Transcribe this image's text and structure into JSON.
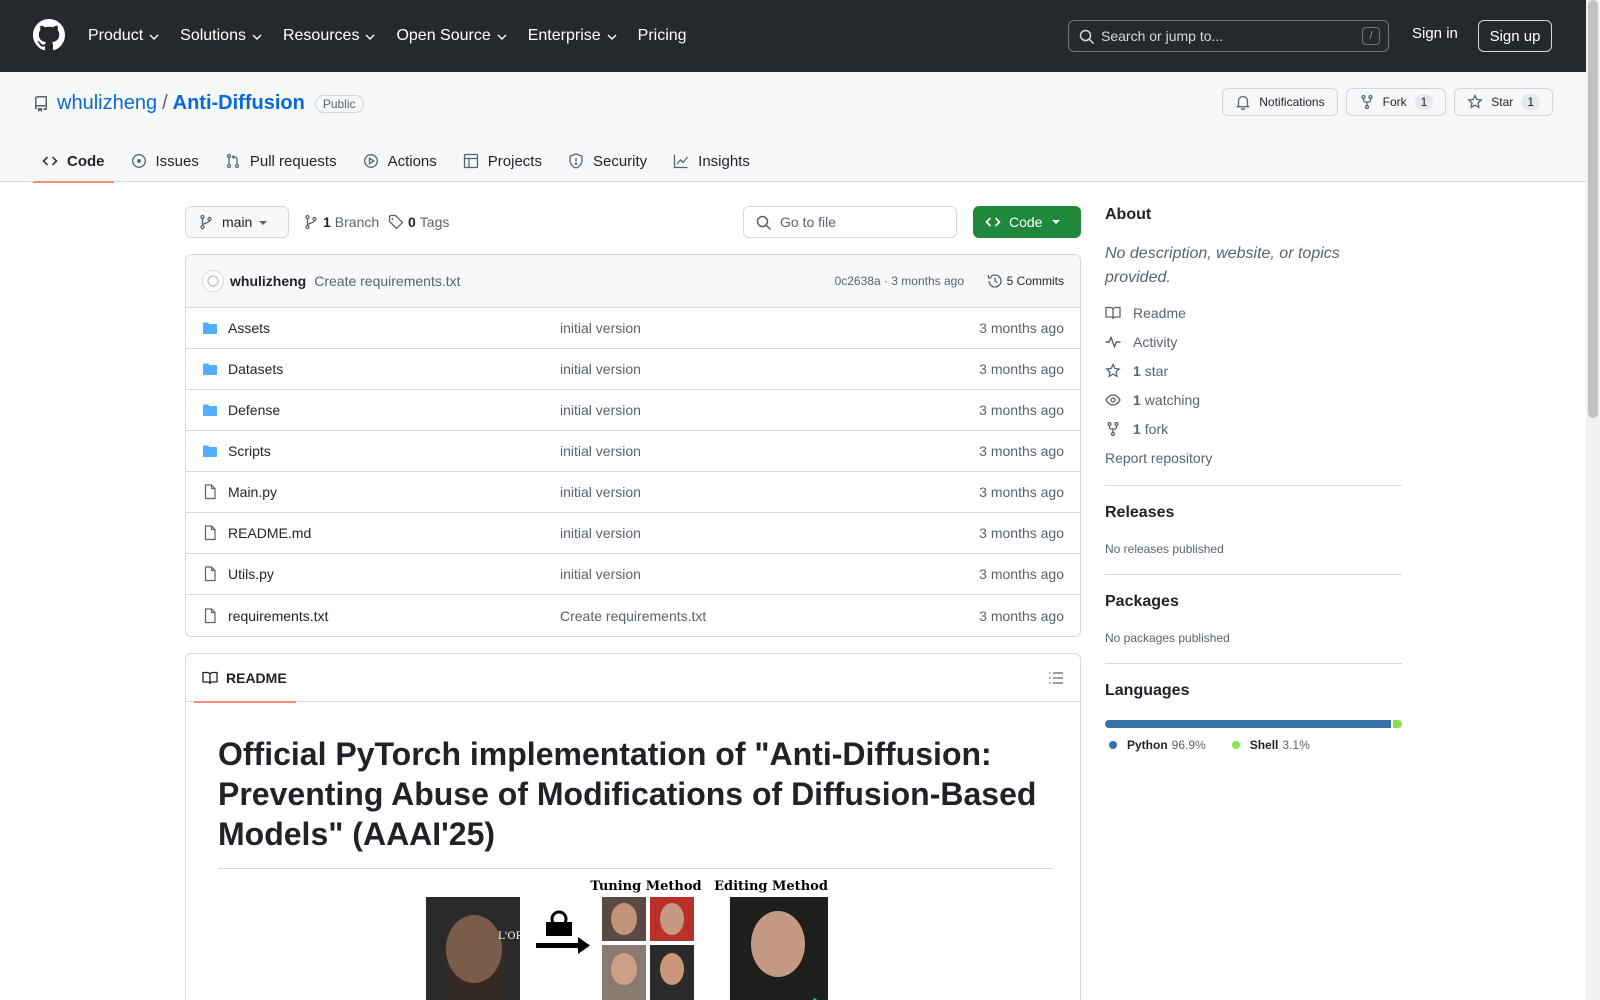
{
  "header": {
    "nav": [
      {
        "label": "Product",
        "chevron": true
      },
      {
        "label": "Solutions",
        "chevron": true
      },
      {
        "label": "Resources",
        "chevron": true
      },
      {
        "label": "Open Source",
        "chevron": true
      },
      {
        "label": "Enterprise",
        "chevron": true
      },
      {
        "label": "Pricing",
        "chevron": false
      }
    ],
    "search_placeholder": "Search or jump to...",
    "search_shortcut": "/",
    "signin": "Sign in",
    "signup": "Sign up"
  },
  "repo": {
    "owner": "whulizheng",
    "separator": "/",
    "name": "Anti-Diffusion",
    "visibility": "Public",
    "notifications": "Notifications",
    "fork_label": "Fork",
    "fork_count": "1",
    "star_label": "Star",
    "star_count": "1"
  },
  "tabs": [
    {
      "label": "Code",
      "icon": "code-icon",
      "active": true
    },
    {
      "label": "Issues",
      "icon": "issue-icon",
      "active": false
    },
    {
      "label": "Pull requests",
      "icon": "pull-request-icon",
      "active": false
    },
    {
      "label": "Actions",
      "icon": "play-icon",
      "active": false
    },
    {
      "label": "Projects",
      "icon": "table-icon",
      "active": false
    },
    {
      "label": "Security",
      "icon": "shield-icon",
      "active": false
    },
    {
      "label": "Insights",
      "icon": "graph-icon",
      "active": false
    }
  ],
  "branchbar": {
    "branch": "main",
    "branch_count": "1",
    "branch_label": "Branch",
    "tag_count": "0",
    "tag_label": "Tags",
    "goto_placeholder": "Go to file",
    "code_button": "Code"
  },
  "commit": {
    "author": "whulizheng",
    "message": "Create requirements.txt",
    "sha_time": "0c2638a · 3 months ago",
    "commits": "5 Commits"
  },
  "files": [
    {
      "type": "folder",
      "name": "Assets",
      "message": "initial version",
      "date": "3 months ago"
    },
    {
      "type": "folder",
      "name": "Datasets",
      "message": "initial version",
      "date": "3 months ago"
    },
    {
      "type": "folder",
      "name": "Defense",
      "message": "initial version",
      "date": "3 months ago"
    },
    {
      "type": "folder",
      "name": "Scripts",
      "message": "initial version",
      "date": "3 months ago"
    },
    {
      "type": "file",
      "name": "Main.py",
      "message": "initial version",
      "date": "3 months ago"
    },
    {
      "type": "file",
      "name": "README.md",
      "message": "initial version",
      "date": "3 months ago"
    },
    {
      "type": "file",
      "name": "Utils.py",
      "message": "initial version",
      "date": "3 months ago"
    },
    {
      "type": "file",
      "name": "requirements.txt",
      "message": "Create requirements.txt",
      "date": "3 months ago"
    }
  ],
  "readme": {
    "tab": "README",
    "title": "Official PyTorch implementation of \"Anti-Diffusion: Preventing Abuse of Modifications of Diffusion-Based Models\" (AAAI'25)",
    "figure_tuning": "Tuning Method",
    "figure_editing": "Editing Method"
  },
  "about": {
    "heading": "About",
    "description": "No description, website, or topics provided.",
    "links": [
      {
        "icon": "book-icon",
        "count": "",
        "label": "Readme"
      },
      {
        "icon": "pulse-icon",
        "count": "",
        "label": "Activity"
      },
      {
        "icon": "star-icon",
        "count": "1",
        "label": "star"
      },
      {
        "icon": "eye-icon",
        "count": "1",
        "label": "watching"
      },
      {
        "icon": "fork-icon",
        "count": "1",
        "label": "fork"
      }
    ],
    "report": "Report repository"
  },
  "releases": {
    "heading": "Releases",
    "empty": "No releases published"
  },
  "packages": {
    "heading": "Packages",
    "empty": "No packages published"
  },
  "languages": {
    "heading": "Languages",
    "items": [
      {
        "name": "Python",
        "percent": "96.9%",
        "value": 96.9,
        "color": "#3572A5"
      },
      {
        "name": "Shell",
        "percent": "3.1%",
        "value": 3.1,
        "color": "#89e051"
      }
    ]
  }
}
